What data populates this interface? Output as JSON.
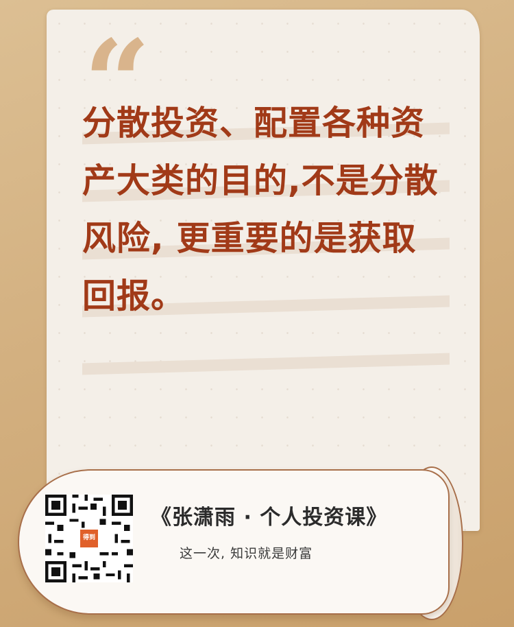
{
  "quote": {
    "mark": "“",
    "lines": [
      "分散投资、配置各种资",
      "产大类的目的,不是分散",
      "风险, 更重要的是获取",
      "回报。"
    ]
  },
  "footer": {
    "course_title": "《张潇雨 · 个人投资课》",
    "slogan": "这一次, 知识就是财富",
    "qr_logo_text": "得到"
  },
  "colors": {
    "accent": "#a13a18",
    "paper": "#f4efe8",
    "background": "#d3b080"
  }
}
